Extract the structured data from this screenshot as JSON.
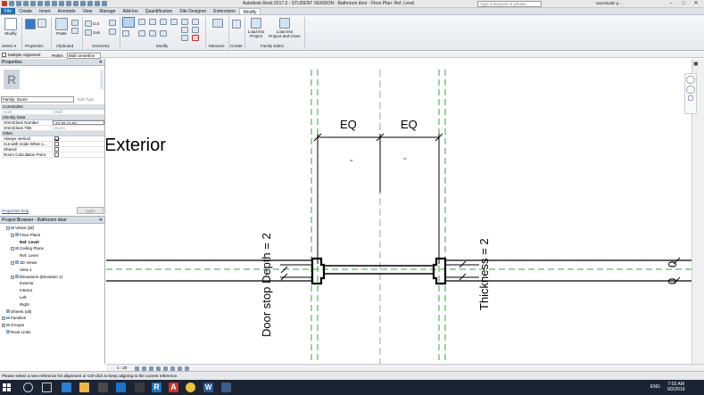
{
  "titlebar": {
    "app_title": "Autodesk Revit 2017.2 - STUDENT VERSION -     Bathroom door - Floor Plan: Ref. Level",
    "search_placeholder": "Type a keyword or phrase",
    "user_name": "tanzinkabir.p...",
    "minimize": "–",
    "maximize": "□",
    "close": "✕"
  },
  "ribbon_tabs": [
    "File",
    "Create",
    "Insert",
    "Annotate",
    "View",
    "Manage",
    "Add-Ins",
    "Quantification",
    "Site Designer",
    "Extensions",
    "Modify"
  ],
  "ribbon": {
    "modify_label": "Modify",
    "paste_label": "Paste",
    "cut_label": "Cut",
    "join_label": "Join",
    "measure_label": "Measure",
    "load_into_project": "Load into\nProject",
    "load_into_project_close": "Load into\nProject and Close",
    "panels": {
      "select": "Select ▾",
      "properties": "Properties",
      "clipboard": "Clipboard",
      "geometry": "Geometry",
      "modify": "Modify",
      "measure": "Measure",
      "create": "Create",
      "family_editor": "Family Editor"
    }
  },
  "options_bar": {
    "multiple_alignment": "Multiple Alignment",
    "prefer_label": "Prefer:",
    "prefer_value": "Wall centerline"
  },
  "properties": {
    "title": "Properties",
    "logo_letter": "R",
    "family_select": "Family: Doors",
    "edit_type": "Edit Type",
    "sections": {
      "constraints": "Constraints",
      "identity": "Identity Data",
      "other": "Other"
    },
    "rows": {
      "host_key": "Host",
      "host_val": "Wall",
      "omniclass_number_key": "OmniClass Number",
      "omniclass_number_val": "23.30.10.00",
      "omniclass_title_key": "OmniClass Title",
      "omniclass_title_val": "Doors",
      "always_vertical": "Always vertical",
      "cut_with_voids": "Cut with Voids When L...",
      "shared": "Shared",
      "room_calc_point": "Room Calculation Point"
    },
    "help_link": "Properties help",
    "apply": "Apply"
  },
  "project_browser": {
    "title": "Project Browser - Bathroom door",
    "items": [
      {
        "label": "Views (all)",
        "indent": 1,
        "toggle": "−"
      },
      {
        "label": "Floor Plans",
        "indent": 2,
        "toggle": "−"
      },
      {
        "label": "Ref. Level",
        "indent": 4,
        "bold": true
      },
      {
        "label": "Ceiling Plans",
        "indent": 2,
        "toggle": "−"
      },
      {
        "label": "Ref. Level",
        "indent": 4
      },
      {
        "label": "3D Views",
        "indent": 2,
        "toggle": "−"
      },
      {
        "label": "View 1",
        "indent": 4
      },
      {
        "label": "Elevations (Elevation 1)",
        "indent": 2,
        "toggle": "−"
      },
      {
        "label": "Exterior",
        "indent": 4
      },
      {
        "label": "Interior",
        "indent": 4
      },
      {
        "label": "Left",
        "indent": 4
      },
      {
        "label": "Right",
        "indent": 4
      },
      {
        "label": "Sheets (all)",
        "indent": 1,
        "toggle": ""
      },
      {
        "label": "Families",
        "indent": 0,
        "toggle": "+"
      },
      {
        "label": "Groups",
        "indent": 0,
        "toggle": "+"
      },
      {
        "label": "Revit Links",
        "indent": 1,
        "toggle": ""
      }
    ]
  },
  "canvas": {
    "exterior": "Exterior",
    "eq_left": "EQ",
    "eq_right": "EQ",
    "door_stop_depth": "Door stop Depth = 2",
    "thickness": "Thickness = 2",
    "zero_top": "0",
    "zero_bottom": "0"
  },
  "view_control": {
    "scale": "1 : 20"
  },
  "status_bar": {
    "message": "Please select a new reference for alignment or Ctrl-click to keep aligning to the current reference."
  },
  "taskbar": {
    "lang": "ENG",
    "time": "7:02 AM",
    "date": "9/2/2019"
  },
  "colors": {
    "ref_plane": "#3aa63a",
    "wall": "#000000",
    "accent": "#1f6fb5"
  }
}
